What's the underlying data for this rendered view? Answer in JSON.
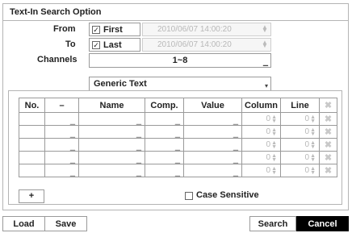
{
  "title": "Text-In Search Option",
  "from": {
    "label": "From",
    "checkbox_label": "First",
    "checked": true,
    "datetime": "2010/06/07  14:00:20"
  },
  "to": {
    "label": "To",
    "checkbox_label": "Last",
    "checked": true,
    "datetime": "2010/06/07  14:00:20"
  },
  "channels": {
    "label": "Channels",
    "value": "1~8"
  },
  "text_type": {
    "value": "Generic Text"
  },
  "table": {
    "headers": [
      "No.",
      "–",
      "Name",
      "Comp.",
      "Value",
      "Column",
      "Line"
    ],
    "rows": [
      {
        "column": "0",
        "line": "0"
      },
      {
        "column": "0",
        "line": "0"
      },
      {
        "column": "0",
        "line": "0"
      },
      {
        "column": "0",
        "line": "0"
      },
      {
        "column": "0",
        "line": "0"
      }
    ]
  },
  "add_button": "+",
  "case_sensitive": {
    "label": "Case Sensitive",
    "checked": false
  },
  "buttons": {
    "load": "Load",
    "save": "Save",
    "search": "Search",
    "cancel": "Cancel"
  },
  "icons": {
    "check": "check-icon",
    "delete": "delete-x-icon",
    "spinner": "spinner-icon",
    "dropdown": "dropdown-icon"
  },
  "colors": {
    "border": "#9a9a9a",
    "disabled_text": "#b8b8b8",
    "cancel_bg": "#000000"
  }
}
